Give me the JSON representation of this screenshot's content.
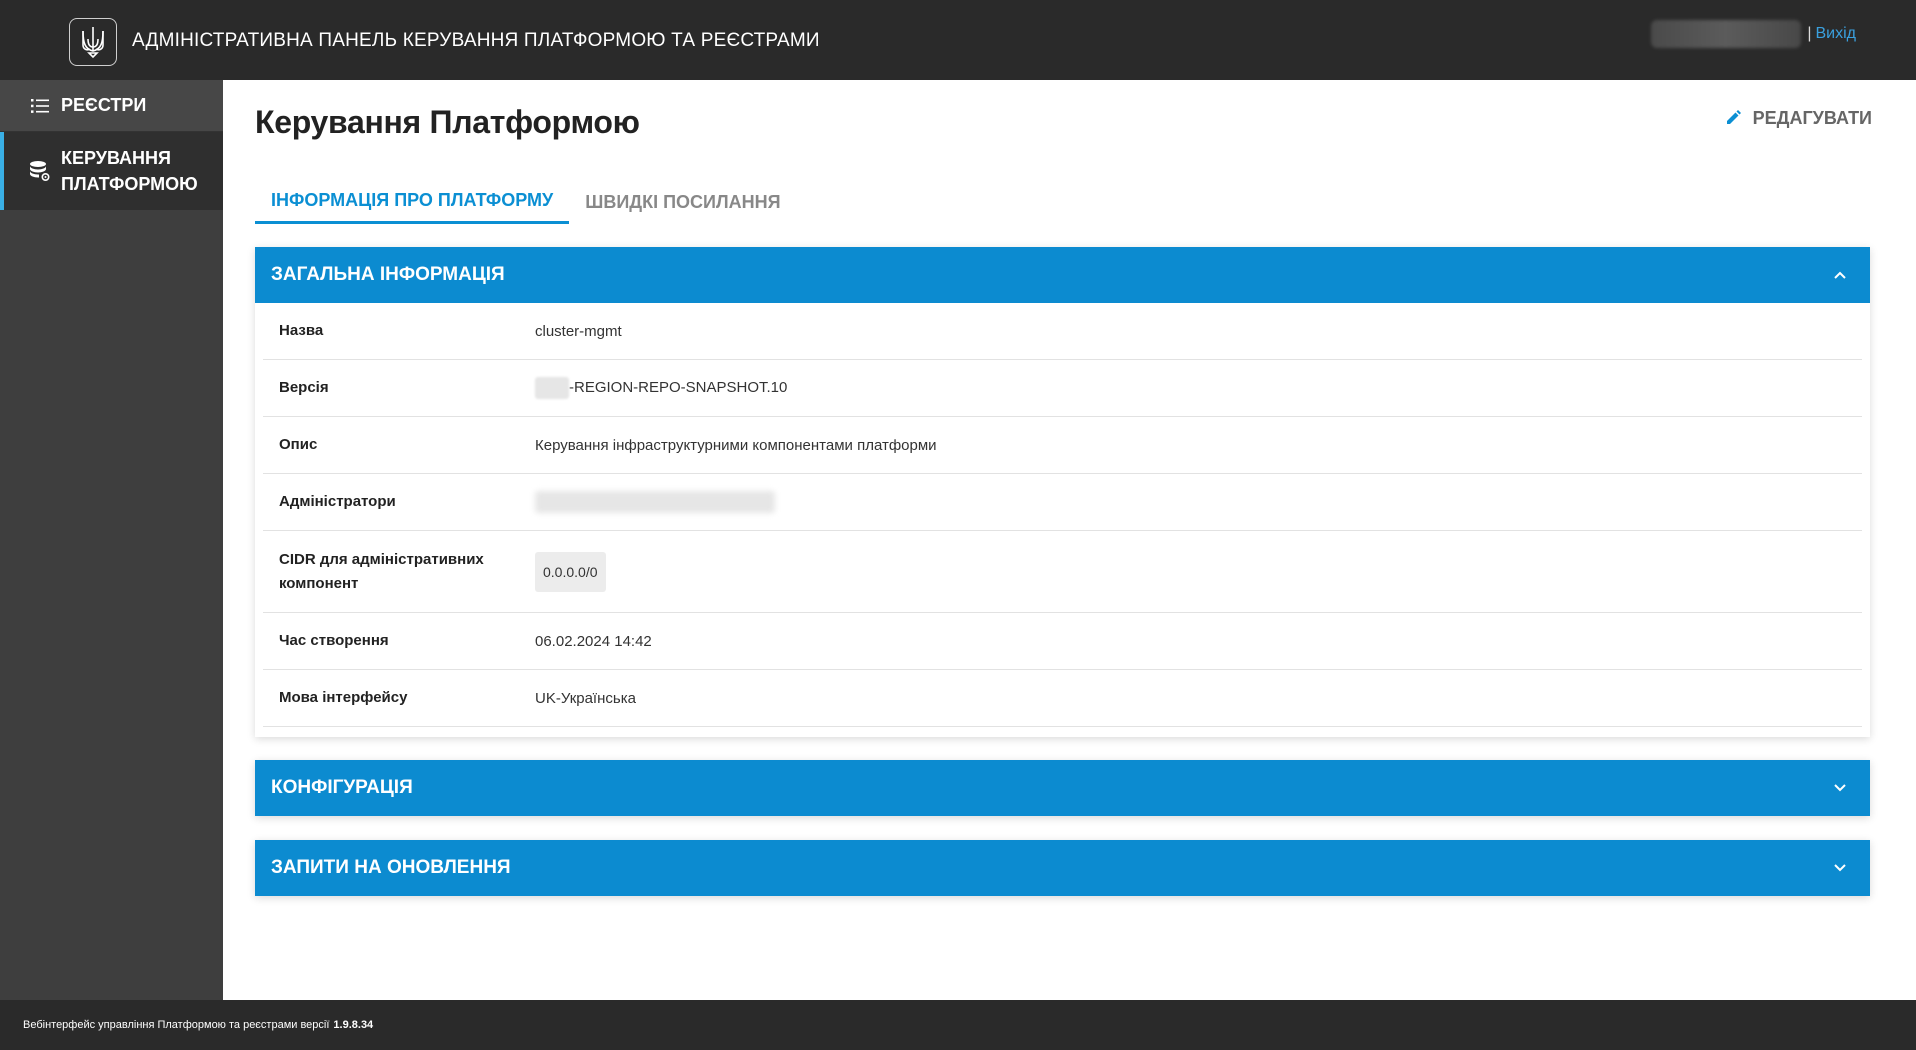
{
  "header": {
    "title": "АДМІНІСТРАТИВНА ПАНЕЛЬ КЕРУВАННЯ ПЛАТФОРМОЮ ТА РЕЄСТРАМИ",
    "separator": "|",
    "logout_label": "Вихід"
  },
  "sidebar": {
    "items": [
      {
        "label": "РЕЄСТРИ",
        "icon": "list-icon"
      },
      {
        "label": "КЕРУВАННЯ ПЛАТФОРМОЮ",
        "icon": "database-gear-icon"
      }
    ]
  },
  "main": {
    "title": "Керування Платформою",
    "edit_label": "РЕДАГУВАТИ",
    "tabs": [
      {
        "label": "ІНФОРМАЦІЯ ПРО ПЛАТФОРМУ",
        "active": true
      },
      {
        "label": "ШВИДКІ ПОСИЛАННЯ",
        "active": false
      }
    ],
    "general": {
      "title": "ЗАГАЛЬНА ІНФОРМАЦІЯ",
      "rows": [
        {
          "key": "Назва",
          "value": "cluster-mgmt"
        },
        {
          "key": "Версія",
          "value": "-REGION-REPO-SNAPSHOT.10"
        },
        {
          "key": "Опис",
          "value": "Керування інфраструктурними компонентами платформи"
        },
        {
          "key": "Адміністратори",
          "value": ""
        },
        {
          "key": "CIDR для адміністративних компонент",
          "value": "0.0.0.0/0"
        },
        {
          "key": "Час створення",
          "value": "06.02.2024 14:42"
        },
        {
          "key": "Мова інтерфейсу",
          "value": "UK-Українська"
        }
      ]
    },
    "config_title": "КОНФІГУРАЦІЯ",
    "updates_title": "ЗАПИТИ НА ОНОВЛЕННЯ"
  },
  "footer": {
    "text": "Вебінтерфейс управління Платформою та реєстрами версії",
    "version": "1.9.8.34"
  },
  "colors": {
    "accent": "#0c8bd0",
    "header_bg": "#2a2a2a",
    "sidebar_bg": "#3e3e3e",
    "link": "#3aa0de"
  }
}
